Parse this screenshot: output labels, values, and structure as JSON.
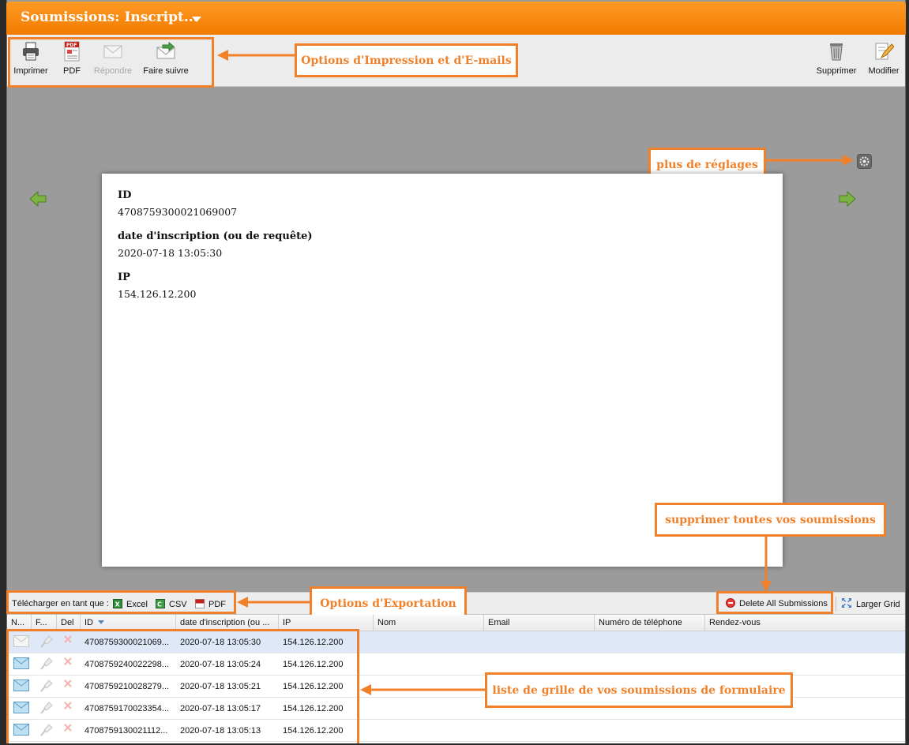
{
  "header": {
    "title": "Soumissions: Inscript..."
  },
  "toolbar": {
    "print": "Imprimer",
    "pdf": "PDF",
    "reply": "Répondre",
    "forward": "Faire suivre",
    "delete": "Supprimer",
    "edit": "Modifier"
  },
  "callouts": {
    "print_email": "Options d'Impression et d'E-mails",
    "settings": "plus de réglages",
    "delete_all": "supprimer toutes vos soumissions",
    "export": "Options d'Exportation",
    "grid": "liste de grille de vos soumissions de formulaire"
  },
  "submission": {
    "fields": [
      {
        "label": "ID",
        "value": "4708759300021069007"
      },
      {
        "label": "date d'inscription (ou de requête)",
        "value": "2020-07-18 13:05:30"
      },
      {
        "label": "IP",
        "value": "154.126.12.200"
      }
    ]
  },
  "export_bar": {
    "download_label": "Télécharger en tant que :",
    "excel": "Excel",
    "csv": "CSV",
    "pdf": "PDF",
    "delete_all": "Delete All Submissions",
    "larger_grid": "Larger Grid"
  },
  "grid": {
    "columns": [
      "N...",
      "F...",
      "Del",
      "ID",
      "date d'inscription (ou ...",
      "IP",
      "Nom",
      "Email",
      "Numéro de téléphone",
      "Rendez-vous"
    ],
    "rows": [
      {
        "id": "4708759300021069...",
        "date": "2020-07-18 13:05:30",
        "ip": "154.126.12.200",
        "read": true
      },
      {
        "id": "4708759240022298...",
        "date": "2020-07-18 13:05:24",
        "ip": "154.126.12.200",
        "read": false
      },
      {
        "id": "4708759210028279...",
        "date": "2020-07-18 13:05:21",
        "ip": "154.126.12.200",
        "read": false
      },
      {
        "id": "4708759170023354...",
        "date": "2020-07-18 13:05:17",
        "ip": "154.126.12.200",
        "read": false
      },
      {
        "id": "4708759130021112...",
        "date": "2020-07-18 13:05:13",
        "ip": "154.126.12.200",
        "read": false
      }
    ]
  },
  "colors": {
    "accent": "#f0812a",
    "titlebar": "#f58300",
    "selected_row": "#dfe8f6"
  }
}
